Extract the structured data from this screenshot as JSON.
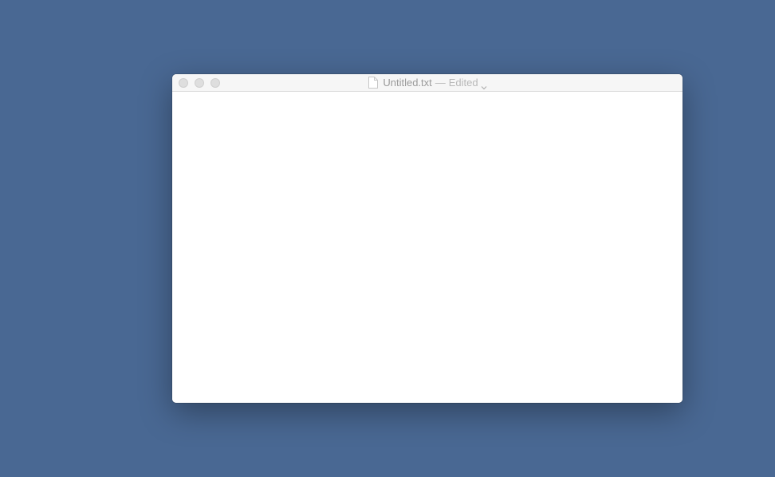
{
  "desktop": {
    "background_color": "#496893"
  },
  "window": {
    "file_name": "Untitled.txt",
    "separator": "—",
    "status": "Edited",
    "document_icon": "document-icon",
    "status_menu_icon": "chevron-down-icon",
    "traffic_lights": [
      "close-button",
      "minimize-button",
      "zoom-button"
    ],
    "editor_text": ""
  }
}
